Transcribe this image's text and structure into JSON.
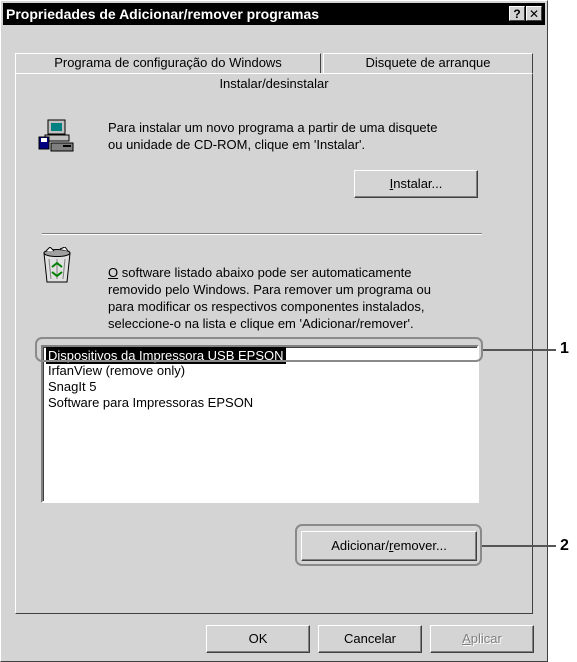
{
  "window": {
    "title": "Propriedades de Adicionar/remover programas",
    "help_glyph": "?",
    "close_glyph": "✕"
  },
  "tabs": [
    {
      "label": "Programa de configuração do Windows"
    },
    {
      "label": "Disquete de arranque"
    },
    {
      "label": "Instalar/desinstalar"
    }
  ],
  "install": {
    "icon": "install-computer-icon",
    "line1": "Para instalar um novo programa a partir de uma disquete",
    "line2": "ou unidade de CD-ROM, clique em 'Instalar'.",
    "button": {
      "mnemonic": "I",
      "rest": "nstalar..."
    }
  },
  "uninstall": {
    "icon": "recycle-bin-icon",
    "line1_mnemonic": "O",
    "line1_rest": " software listado abaixo pode ser automaticamente",
    "line2": "removido pelo Windows. Para remover um programa ou",
    "line3": "para modificar os respectivos componentes instalados,",
    "line4": "seleccione-o na lista e clique em 'Adicionar/remover'."
  },
  "programs": [
    {
      "name": "Dispositivos da Impressora USB EPSON",
      "selected": true
    },
    {
      "name": "IrfanView (remove only)",
      "selected": false
    },
    {
      "name": "SnagIt 5",
      "selected": false
    },
    {
      "name": "Software para Impressoras EPSON",
      "selected": false
    }
  ],
  "add_remove_button": {
    "before": "Adicionar/",
    "mnemonic": "r",
    "after": "emover..."
  },
  "footer": {
    "ok": "OK",
    "cancel": "Cancelar",
    "apply_mnemonic": "A",
    "apply_rest": "plicar"
  },
  "callouts": [
    "1",
    "2"
  ],
  "colors": {
    "selection": "#000000",
    "face": "#d4d4d4",
    "callout": "#8a8a8a"
  }
}
